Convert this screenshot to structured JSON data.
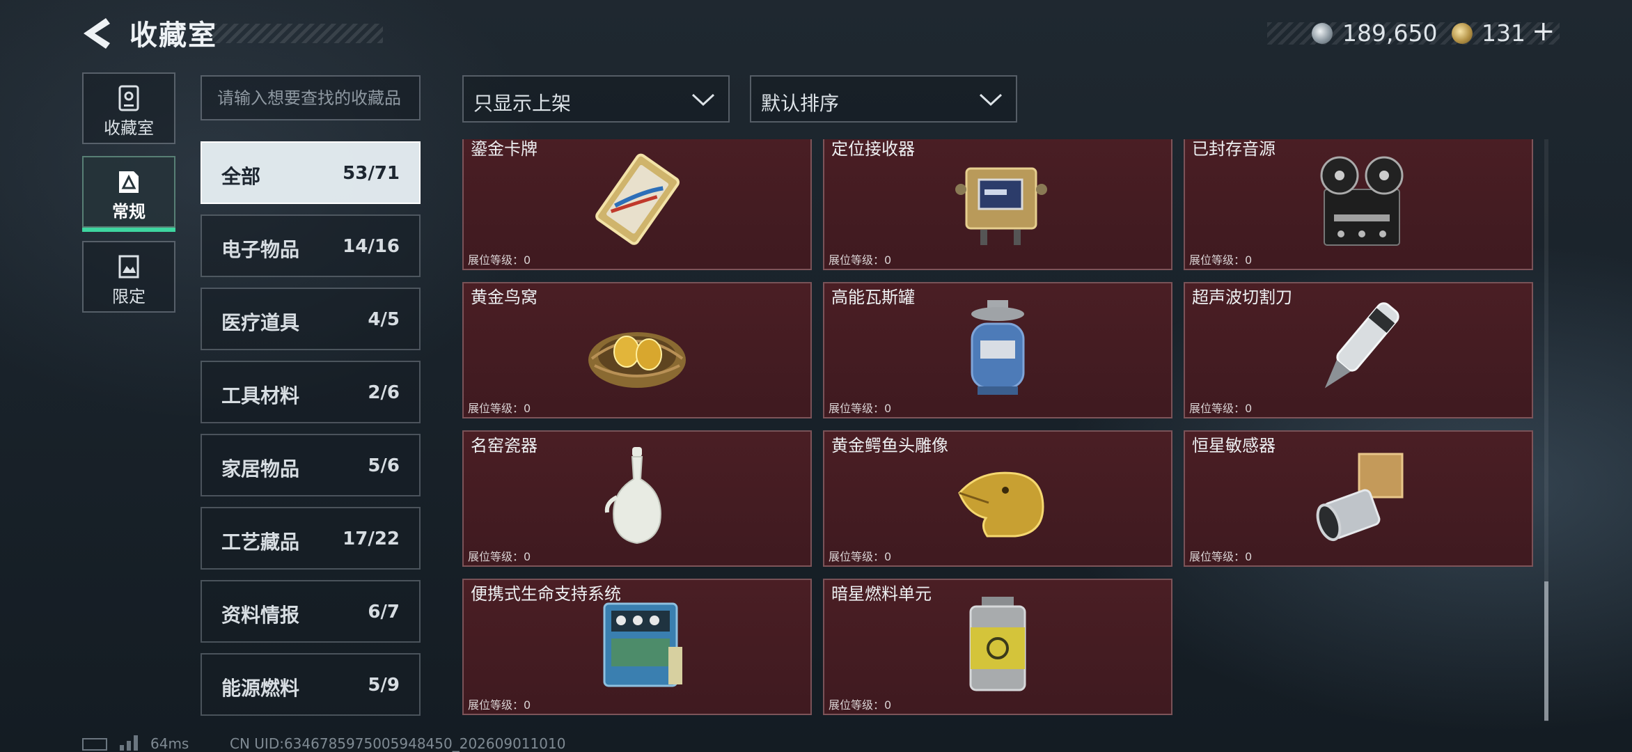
{
  "header": {
    "title": "收藏室",
    "currency": [
      {
        "name": "silver-coin",
        "value": "189,650"
      },
      {
        "name": "gold-coin",
        "value": "131"
      }
    ],
    "add_label": "+"
  },
  "side_tabs": [
    {
      "label": "收藏室",
      "icon": "cabinet-icon",
      "active": false
    },
    {
      "label": "常规",
      "icon": "card-icon",
      "active": true
    },
    {
      "label": "限定",
      "icon": "image-frame-icon",
      "active": false
    }
  ],
  "search": {
    "placeholder": "请输入想要查找的收藏品"
  },
  "categories": [
    {
      "name": "全部",
      "count": "53/71",
      "active": true
    },
    {
      "name": "电子物品",
      "count": "14/16"
    },
    {
      "name": "医疗道具",
      "count": "4/5"
    },
    {
      "name": "工具材料",
      "count": "2/6"
    },
    {
      "name": "家居物品",
      "count": "5/6"
    },
    {
      "name": "工艺藏品",
      "count": "17/22"
    },
    {
      "name": "资料情报",
      "count": "6/7"
    },
    {
      "name": "能源燃料",
      "count": "5/9"
    }
  ],
  "filters": {
    "filter_label": "只显示上架",
    "sort_label": "默认排序"
  },
  "level_label": "展位等级：",
  "items": [
    {
      "name": "鎏金卡牌",
      "level": "0",
      "icon": "gilded-card-icon"
    },
    {
      "name": "定位接收器",
      "level": "0",
      "icon": "locator-receiver-icon"
    },
    {
      "name": "已封存音源",
      "level": "0",
      "icon": "reel-to-reel-recorder-icon"
    },
    {
      "name": "黄金鸟窝",
      "level": "0",
      "icon": "golden-nest-icon"
    },
    {
      "name": "高能瓦斯罐",
      "level": "0",
      "icon": "gas-canister-icon"
    },
    {
      "name": "超声波切割刀",
      "level": "0",
      "icon": "ultrasonic-cutter-icon"
    },
    {
      "name": "名窑瓷器",
      "level": "0",
      "icon": "porcelain-vase-icon"
    },
    {
      "name": "黄金鳄鱼头雕像",
      "level": "0",
      "icon": "golden-crocodile-statue-icon"
    },
    {
      "name": "恒星敏感器",
      "level": "0",
      "icon": "star-sensor-icon"
    },
    {
      "name": "便携式生命支持系统",
      "level": "0",
      "icon": "life-support-system-icon"
    },
    {
      "name": "暗星燃料单元",
      "level": "0",
      "icon": "fuel-cell-icon"
    }
  ],
  "status": {
    "ping": "64ms",
    "uid": "CN UID:6346785975005948450_202609011010"
  }
}
